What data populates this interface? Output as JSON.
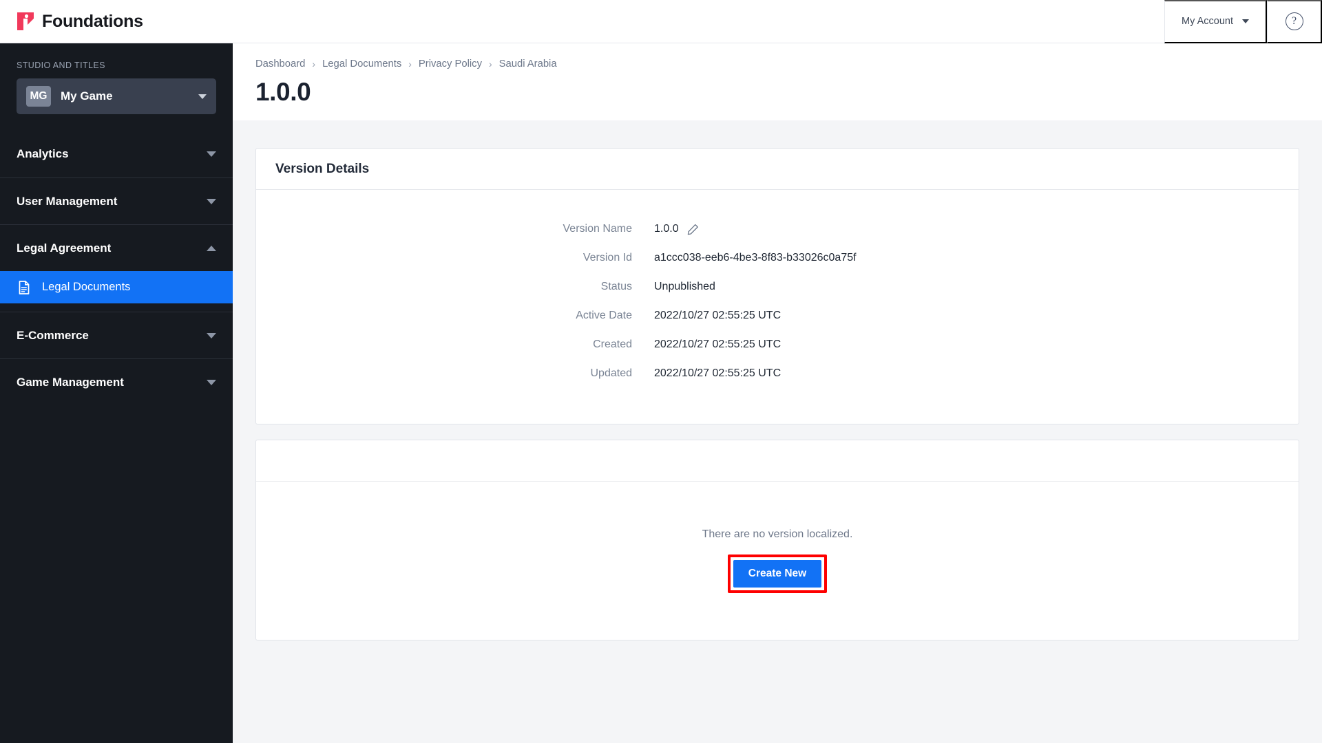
{
  "topbar": {
    "brand_name": "Foundations",
    "account_label": "My Account",
    "help_label": "?"
  },
  "sidebar": {
    "section_label": "STUDIO AND TITLES",
    "studio": {
      "initials": "MG",
      "name": "My Game"
    },
    "groups": [
      {
        "label": "Analytics",
        "expanded": false
      },
      {
        "label": "User Management",
        "expanded": false
      },
      {
        "label": "Legal Agreement",
        "expanded": true
      },
      {
        "label": "E-Commerce",
        "expanded": false
      },
      {
        "label": "Game Management",
        "expanded": false
      }
    ],
    "legal_items": [
      {
        "label": "Legal Documents",
        "active": true
      }
    ]
  },
  "breadcrumb": [
    "Dashboard",
    "Legal Documents",
    "Privacy Policy",
    "Saudi Arabia"
  ],
  "page": {
    "title": "1.0.0"
  },
  "version_details": {
    "card_title": "Version Details",
    "rows": [
      {
        "label": "Version Name",
        "value": "1.0.0",
        "editable": true
      },
      {
        "label": "Version Id",
        "value": "a1ccc038-eeb6-4be3-8f83-b33026c0a75f",
        "editable": false
      },
      {
        "label": "Status",
        "value": "Unpublished",
        "editable": false
      },
      {
        "label": "Active Date",
        "value": "2022/10/27 02:55:25 UTC",
        "editable": false
      },
      {
        "label": "Created",
        "value": "2022/10/27 02:55:25 UTC",
        "editable": false
      },
      {
        "label": "Updated",
        "value": "2022/10/27 02:55:25 UTC",
        "editable": false
      }
    ]
  },
  "localization": {
    "empty_text": "There are no version localized.",
    "create_button": "Create New"
  },
  "colors": {
    "brand_pink": "#f1395b",
    "accent_blue": "#1272f5",
    "sidebar_bg": "#161a20",
    "highlight_red": "#fe0000",
    "content_bg": "#f4f5f7"
  }
}
